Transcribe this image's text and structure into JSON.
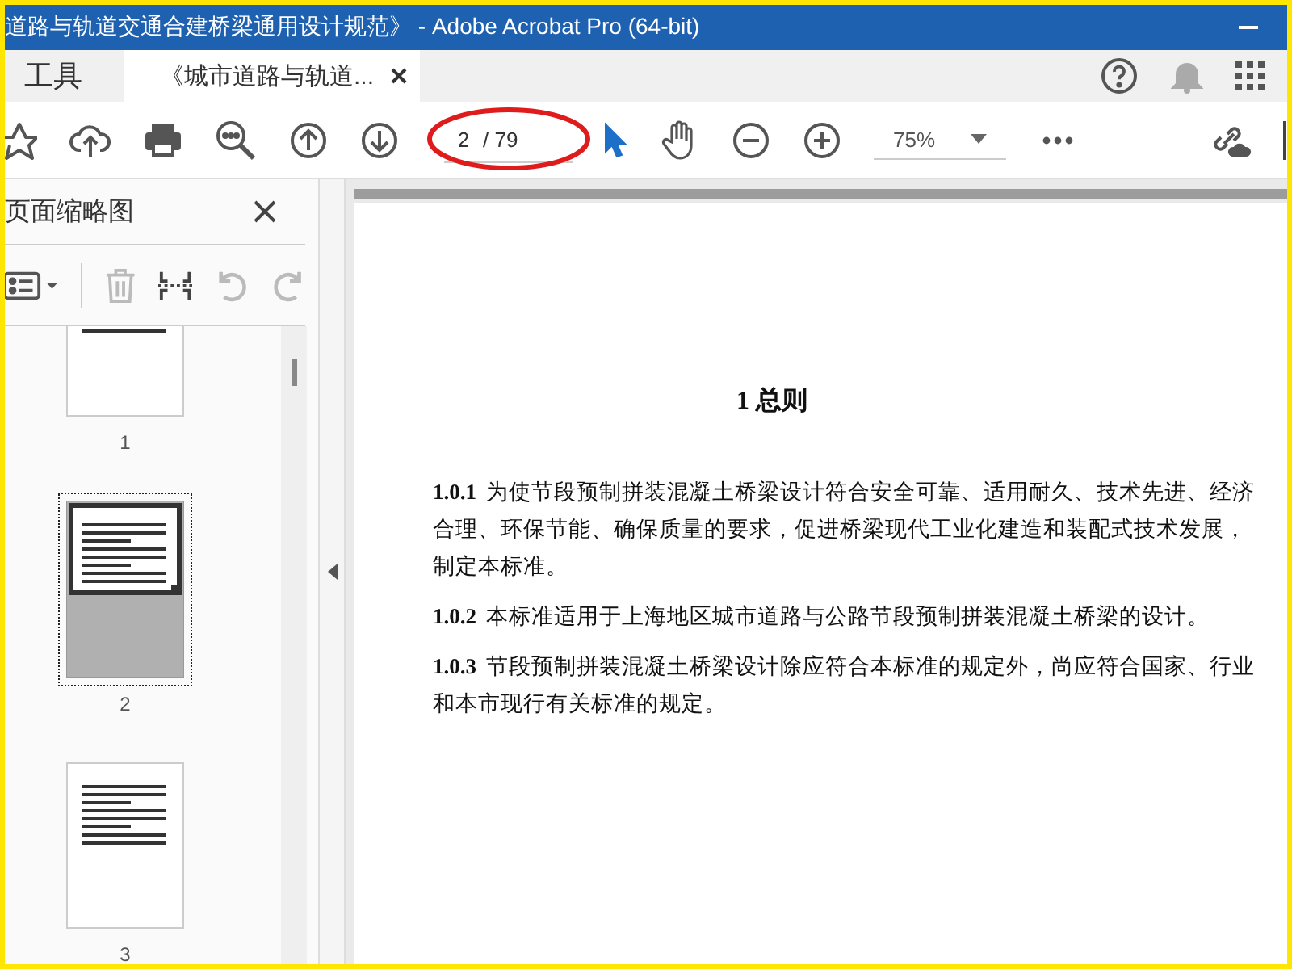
{
  "window": {
    "title": "道路与轨道交通合建桥梁通用设计规范》 - Adobe Acrobat Pro (64-bit)"
  },
  "tabs": [
    {
      "label": "工具",
      "selected": false
    },
    {
      "label": "《城市道路与轨道...",
      "selected": true
    }
  ],
  "toolbar": {
    "page_field": {
      "value": "2",
      "total": "/ 79"
    },
    "zoom": {
      "value": "75%"
    }
  },
  "sidebar": {
    "title": "页面缩略图",
    "thumbnails": [
      {
        "label": "1",
        "selected": false
      },
      {
        "label": "2",
        "selected": true
      },
      {
        "label": "3",
        "selected": false
      }
    ]
  },
  "document": {
    "heading": "1  总则",
    "paragraphs": [
      {
        "number": "1.0.1",
        "text": "为使节段预制拼装混凝土桥梁设计符合安全可靠、适用耐久、技术先进、经济合理、环保节能、确保质量的要求，促进桥梁现代工业化建造和装配式技术发展，制定本标准。"
      },
      {
        "number": "1.0.2",
        "text": "本标准适用于上海地区城市道路与公路节段预制拼装混凝土桥梁的设计。"
      },
      {
        "number": "1.0.3",
        "text": "节段预制拼装混凝土桥梁设计除应符合本标准的规定外，尚应符合国家、行业和本市现行有关标准的规定。"
      }
    ]
  }
}
